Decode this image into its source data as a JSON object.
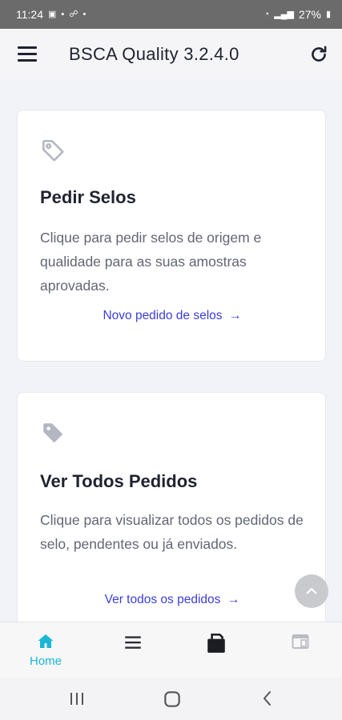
{
  "status_bar": {
    "time": "11:24",
    "battery": "27%",
    "left_icons": [
      "image-icon",
      "message-icon",
      "link-icon",
      "dot-icon"
    ],
    "right_icons": [
      "wifi-icon",
      "signal-icon",
      "battery-icon"
    ]
  },
  "app_bar": {
    "title": "BSCA Quality 3.2.4.0"
  },
  "cards": [
    {
      "icon": "tag-outline-icon",
      "title": "Pedir Selos",
      "description": "Clique para pedir selos de origem e qualidade para as suas amostras aprovadas.",
      "link": "Novo pedido de selos"
    },
    {
      "icon": "tag-filled-icon",
      "title": "Ver Todos Pedidos",
      "description": "Clique para visualizar todos os pedidos de selo, pendentes ou já enviados.",
      "link": "Ver todos os pedidos"
    }
  ],
  "bottom_nav": {
    "items": [
      {
        "icon": "home-icon",
        "label": "Home",
        "active": true
      },
      {
        "icon": "list-icon",
        "label": ""
      },
      {
        "icon": "order-box-icon",
        "label": ""
      },
      {
        "icon": "window-icon",
        "label": ""
      }
    ]
  },
  "colors": {
    "accent": "#19b6d6",
    "link": "#3b3fd6",
    "background": "#f1f3f9"
  }
}
